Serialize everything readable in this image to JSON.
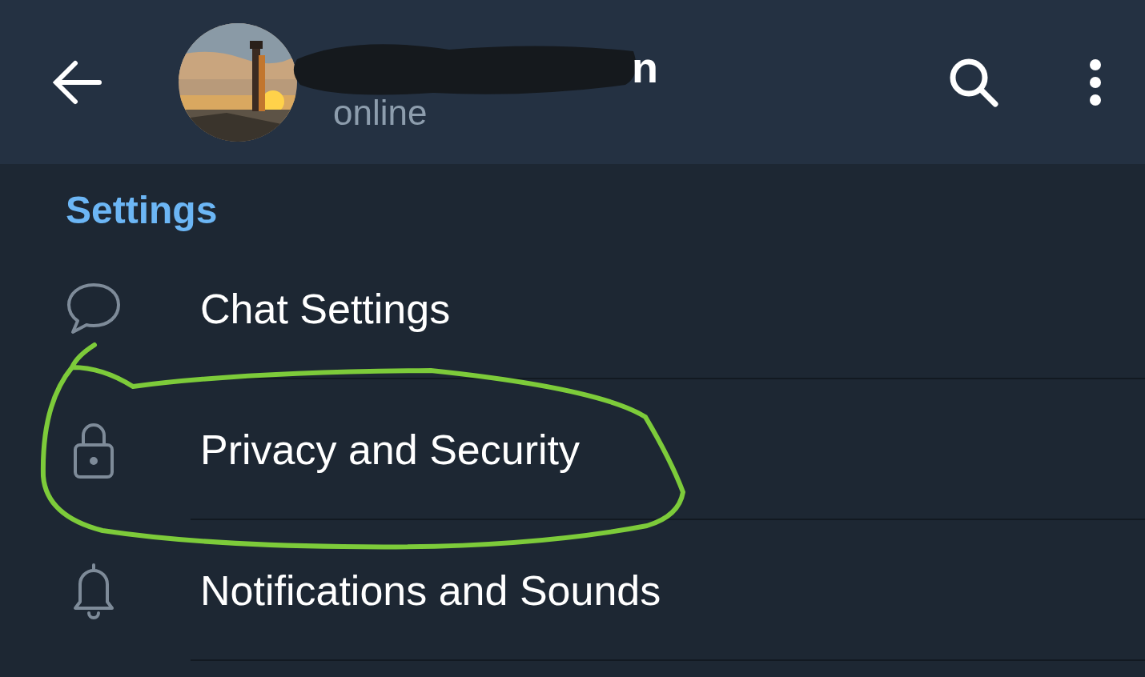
{
  "header": {
    "name_visible": "n",
    "status": "online"
  },
  "section_title": "Settings",
  "items": [
    {
      "label": "Chat Settings"
    },
    {
      "label": "Privacy and Security"
    },
    {
      "label": "Notifications and Sounds"
    }
  ]
}
